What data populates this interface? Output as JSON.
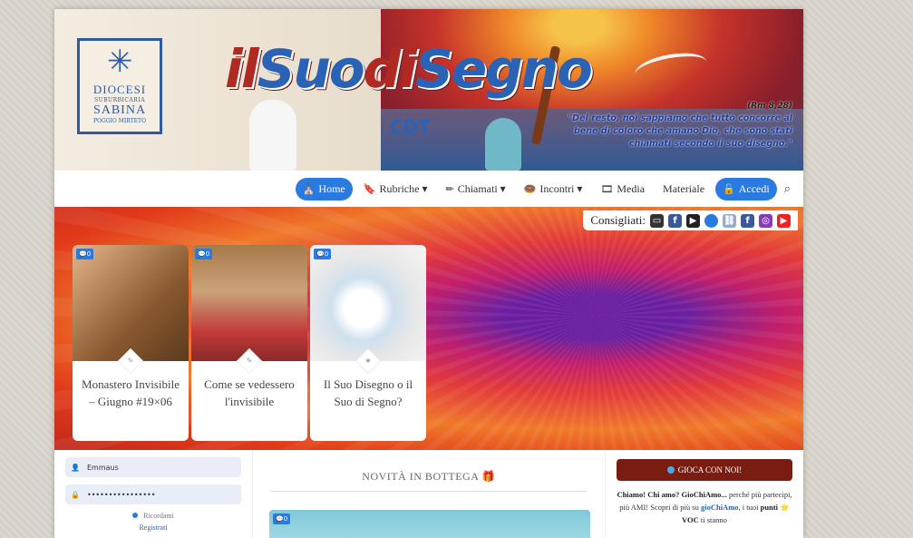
{
  "header": {
    "diocesi": {
      "line1": "DIOCESI",
      "line2": "SUBURBICARIA",
      "line3": "SABINA",
      "line4": "POGGIO MIRTETO"
    },
    "logo_part1": "il",
    "logo_part2": "Suo",
    "logo_part3": "di",
    "logo_part4": "Segno",
    "quote_ref": "(Rm 8,28)",
    "quote_text": "\"Del resto, noi sappiamo che tutto concorre al bene di coloro che amano Dio, che sono stati chiamati secondo il suo disegno.\"",
    "cdt_logo": "CDT"
  },
  "nav": {
    "items": [
      {
        "label": "Home",
        "icon": "⛪",
        "active": true
      },
      {
        "label": "Rubriche ▾",
        "icon": "🔖"
      },
      {
        "label": "Chiamati ▾",
        "icon": "✏"
      },
      {
        "label": "Incontri ▾",
        "icon": "🍩"
      },
      {
        "label": "Media",
        "icon": "🎞"
      },
      {
        "label": "Materiale",
        "icon": ""
      },
      {
        "label": "Accedi",
        "icon": "🔓",
        "active": true
      }
    ],
    "search_icon": "search-icon"
  },
  "consigliati": {
    "label": "Consigliati:",
    "icons": [
      "monitor-icon",
      "facebook-icon",
      "youtube-icon",
      "circle-icon",
      "link-icon",
      "facebook-icon",
      "instagram-icon",
      "youtube-icon"
    ]
  },
  "cards": [
    {
      "badge": "💬0",
      "title": "Monastero Invisibile – Giugno #19×06",
      "img_color": "#b7733f"
    },
    {
      "badge": "💬0",
      "title": "Come se vedessero l'invisibile",
      "img_color": "#b58e5d"
    },
    {
      "badge": "💬0",
      "title": "Il Suo Disegno o il Suo di Segno?",
      "img_color": "#f2f2f2"
    }
  ],
  "login": {
    "username": "Emmaus",
    "password": "••••••••••••••••",
    "remember": "Ricordami",
    "register": "Registrati"
  },
  "center": {
    "heading": "NOVITÀ IN BOTTEGA 🎁",
    "badge": "💬0"
  },
  "right": {
    "gioca_label": "GIOCA CON NOI!",
    "text_bold": "Chiamo! Chi amo? GioChiAmo...",
    "text_1": " perché più partecipi, più AMI! Scopri di più su ",
    "text_link": "gioChiAmo",
    "text_2": ", i tuoi ",
    "text_punti": "punti",
    "text_3": " ⭐ ",
    "text_voc": "VOC",
    "text_4": " ti stanno"
  }
}
